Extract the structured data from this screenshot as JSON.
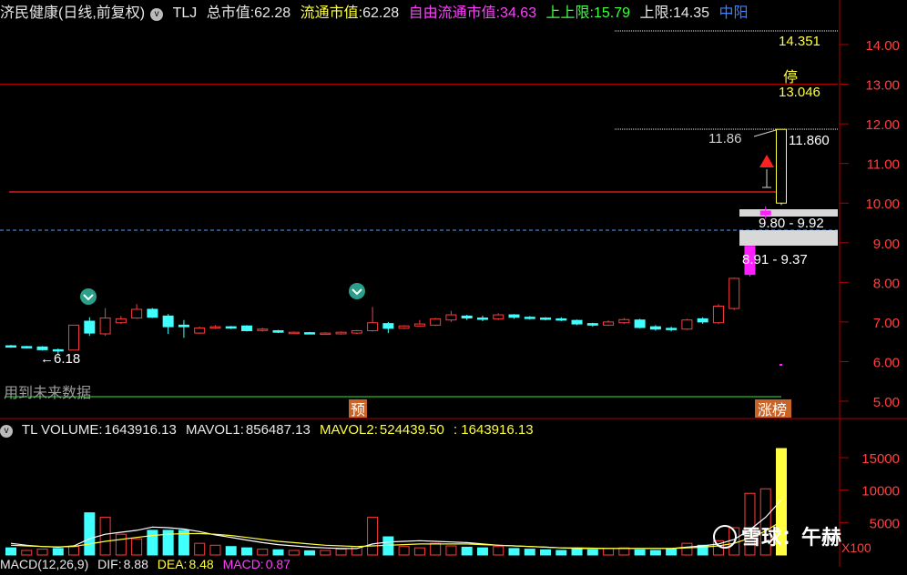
{
  "header": {
    "stock_name": "济民健康(日线,前复权)",
    "indicator": "TLJ",
    "total_mcap_label": "总市值:",
    "total_mcap": "62.28",
    "float_mcap_label": "流通市值:",
    "float_mcap": "62.28",
    "free_float_label": "自由流通市值:",
    "free_float": "34.63",
    "upper_limit2_label": "上上限:",
    "upper_limit2": "15.79",
    "upper_limit_label": "上限:",
    "upper_limit": "14.35",
    "truncated_label": "中阳"
  },
  "price_axis": {
    "ticks": [
      "14.00",
      "13.00",
      "12.00",
      "11.00",
      "10.00",
      "9.00",
      "8.00",
      "7.00",
      "6.00",
      "5.00"
    ]
  },
  "price_labels": {
    "level_14": "14.351",
    "stop_char": "停",
    "level_13": "13.046",
    "high_left": "11.86",
    "high_right": "11.860",
    "gap_upper": "9.80 - 9.92",
    "gap_lower": "8.91 - 9.37",
    "low_marker": "6.18",
    "future_data_note": "用到未来数据",
    "pre_tag": "预",
    "limit_up_tag": "涨榜"
  },
  "volume_header": {
    "name": "TL VOLUME:",
    "volume": "1643916.13",
    "mavol1_label": "MAVOL1:",
    "mavol1": "856487.13",
    "mavol2_label": "MAVOL2:",
    "mavol2": "524439.50",
    "extra": ": 1643916.13"
  },
  "volume_axis": {
    "ticks": [
      "15000",
      "10000",
      "5000"
    ],
    "unit": "X100"
  },
  "macd_header": {
    "name": "MACD(12,26,9)",
    "dif_label": "DIF:",
    "dif": "8.88",
    "dea_label": "DEA:",
    "dea": "8.48",
    "macd_label": "MACD:",
    "macd": "0.87"
  },
  "watermark": "雪球：午赫",
  "colors": {
    "up": "#ff3b3b",
    "down": "#40ffff",
    "limit": "#ff20ff",
    "ma1": "#ffffff",
    "ma2": "#ffff40",
    "grid": "#b00000"
  },
  "chart_data": {
    "type": "candlestick",
    "x_label": "",
    "y_range": [
      4.7,
      14.5
    ],
    "candles": [
      {
        "o": 6.4,
        "c": 6.38,
        "h": 6.42,
        "l": 6.35
      },
      {
        "o": 6.38,
        "c": 6.36,
        "h": 6.4,
        "l": 6.33
      },
      {
        "o": 6.37,
        "c": 6.3,
        "h": 6.39,
        "l": 6.28
      },
      {
        "o": 6.3,
        "c": 6.29,
        "h": 6.33,
        "l": 6.18
      },
      {
        "o": 6.29,
        "c": 6.92,
        "h": 6.92,
        "l": 6.29
      },
      {
        "o": 7.02,
        "c": 6.72,
        "h": 7.12,
        "l": 6.65
      },
      {
        "o": 6.7,
        "c": 7.1,
        "h": 7.35,
        "l": 6.65
      },
      {
        "o": 6.98,
        "c": 7.08,
        "h": 7.15,
        "l": 6.95
      },
      {
        "o": 7.1,
        "c": 7.32,
        "h": 7.45,
        "l": 7.08
      },
      {
        "o": 7.32,
        "c": 7.12,
        "h": 7.35,
        "l": 7.1
      },
      {
        "o": 7.15,
        "c": 6.88,
        "h": 7.2,
        "l": 6.7
      },
      {
        "o": 6.92,
        "c": 6.88,
        "h": 7.05,
        "l": 6.6
      },
      {
        "o": 6.72,
        "c": 6.85,
        "h": 6.88,
        "l": 6.7
      },
      {
        "o": 6.85,
        "c": 6.88,
        "h": 6.92,
        "l": 6.82
      },
      {
        "o": 6.88,
        "c": 6.86,
        "h": 6.9,
        "l": 6.82
      },
      {
        "o": 6.9,
        "c": 6.78,
        "h": 6.92,
        "l": 6.76
      },
      {
        "o": 6.8,
        "c": 6.82,
        "h": 6.85,
        "l": 6.76
      },
      {
        "o": 6.78,
        "c": 6.74,
        "h": 6.8,
        "l": 6.72
      },
      {
        "o": 6.72,
        "c": 6.74,
        "h": 6.76,
        "l": 6.7
      },
      {
        "o": 6.73,
        "c": 6.72,
        "h": 6.75,
        "l": 6.7
      },
      {
        "o": 6.72,
        "c": 6.72,
        "h": 6.74,
        "l": 6.7
      },
      {
        "o": 6.7,
        "c": 6.74,
        "h": 6.76,
        "l": 6.68
      },
      {
        "o": 6.72,
        "c": 6.78,
        "h": 6.8,
        "l": 6.7
      },
      {
        "o": 6.78,
        "c": 6.98,
        "h": 7.38,
        "l": 6.76
      },
      {
        "o": 6.96,
        "c": 6.84,
        "h": 7.0,
        "l": 6.72
      },
      {
        "o": 6.84,
        "c": 6.9,
        "h": 6.92,
        "l": 6.82
      },
      {
        "o": 6.9,
        "c": 6.95,
        "h": 7.05,
        "l": 6.88
      },
      {
        "o": 6.92,
        "c": 7.08,
        "h": 7.1,
        "l": 6.9
      },
      {
        "o": 7.05,
        "c": 7.18,
        "h": 7.28,
        "l": 7.0
      },
      {
        "o": 7.15,
        "c": 7.1,
        "h": 7.18,
        "l": 7.05
      },
      {
        "o": 7.1,
        "c": 7.08,
        "h": 7.16,
        "l": 7.02
      },
      {
        "o": 7.08,
        "c": 7.18,
        "h": 7.22,
        "l": 7.05
      },
      {
        "o": 7.18,
        "c": 7.12,
        "h": 7.2,
        "l": 7.08
      },
      {
        "o": 7.12,
        "c": 7.1,
        "h": 7.15,
        "l": 7.06
      },
      {
        "o": 7.1,
        "c": 7.08,
        "h": 7.12,
        "l": 7.04
      },
      {
        "o": 7.08,
        "c": 7.06,
        "h": 7.12,
        "l": 7.02
      },
      {
        "o": 7.04,
        "c": 6.95,
        "h": 7.06,
        "l": 6.92
      },
      {
        "o": 6.96,
        "c": 6.92,
        "h": 6.98,
        "l": 6.88
      },
      {
        "o": 6.92,
        "c": 7.0,
        "h": 7.04,
        "l": 6.9
      },
      {
        "o": 6.98,
        "c": 7.06,
        "h": 7.1,
        "l": 6.95
      },
      {
        "o": 7.05,
        "c": 6.86,
        "h": 7.08,
        "l": 6.84
      },
      {
        "o": 6.88,
        "c": 6.82,
        "h": 6.92,
        "l": 6.78
      },
      {
        "o": 6.84,
        "c": 6.82,
        "h": 6.88,
        "l": 6.76
      },
      {
        "o": 6.82,
        "c": 7.05,
        "h": 7.08,
        "l": 6.8
      },
      {
        "o": 7.08,
        "c": 7.0,
        "h": 7.12,
        "l": 6.95
      },
      {
        "o": 6.98,
        "c": 7.4,
        "h": 7.45,
        "l": 6.95
      },
      {
        "o": 7.34,
        "c": 8.1,
        "h": 8.12,
        "l": 7.3
      },
      {
        "o": 8.2,
        "c": 8.91,
        "h": 8.91,
        "l": 8.15
      },
      {
        "o": 9.7,
        "c": 9.8,
        "h": 9.92,
        "l": 9.6
      },
      {
        "o": 10.0,
        "c": 11.86,
        "h": 11.86,
        "l": 9.95
      }
    ],
    "volumes": [
      {
        "v": 1100,
        "up": false
      },
      {
        "v": 700,
        "up": true
      },
      {
        "v": 900,
        "up": true
      },
      {
        "v": 1000,
        "up": false
      },
      {
        "v": 1300,
        "up": true
      },
      {
        "v": 6500,
        "up": false
      },
      {
        "v": 5800,
        "up": true
      },
      {
        "v": 3200,
        "up": true
      },
      {
        "v": 2500,
        "up": true
      },
      {
        "v": 3800,
        "up": false
      },
      {
        "v": 3800,
        "up": false
      },
      {
        "v": 3800,
        "up": false
      },
      {
        "v": 1800,
        "up": true
      },
      {
        "v": 1500,
        "up": true
      },
      {
        "v": 1300,
        "up": false
      },
      {
        "v": 1100,
        "up": false
      },
      {
        "v": 900,
        "up": true
      },
      {
        "v": 800,
        "up": false
      },
      {
        "v": 700,
        "up": true
      },
      {
        "v": 650,
        "up": false
      },
      {
        "v": 700,
        "up": true
      },
      {
        "v": 900,
        "up": true
      },
      {
        "v": 1300,
        "up": true
      },
      {
        "v": 5800,
        "up": true
      },
      {
        "v": 2800,
        "up": false
      },
      {
        "v": 1300,
        "up": true
      },
      {
        "v": 1100,
        "up": true
      },
      {
        "v": 1800,
        "up": true
      },
      {
        "v": 1400,
        "up": true
      },
      {
        "v": 1200,
        "up": false
      },
      {
        "v": 1100,
        "up": false
      },
      {
        "v": 1300,
        "up": true
      },
      {
        "v": 1000,
        "up": false
      },
      {
        "v": 900,
        "up": false
      },
      {
        "v": 800,
        "up": false
      },
      {
        "v": 700,
        "up": false
      },
      {
        "v": 900,
        "up": false
      },
      {
        "v": 800,
        "up": false
      },
      {
        "v": 1000,
        "up": true
      },
      {
        "v": 1100,
        "up": true
      },
      {
        "v": 800,
        "up": false
      },
      {
        "v": 700,
        "up": false
      },
      {
        "v": 900,
        "up": false
      },
      {
        "v": 1800,
        "up": true
      },
      {
        "v": 1500,
        "up": false
      },
      {
        "v": 2200,
        "up": true
      },
      {
        "v": 4200,
        "up": true
      },
      {
        "v": 9500,
        "up": true
      },
      {
        "v": 10200,
        "up": true
      },
      {
        "v": 16400,
        "up": true
      }
    ],
    "volume_range": [
      0,
      17500
    ],
    "mavol1": [
      1800,
      1500,
      1300,
      1200,
      1400,
      2500,
      3200,
      3500,
      3800,
      4300,
      4200,
      4000,
      3600,
      3100,
      2700,
      2300,
      1900,
      1600,
      1400,
      1200,
      1100,
      1000,
      1000,
      1700,
      2000,
      2100,
      2200,
      2100,
      2000,
      1900,
      1700,
      1500,
      1400,
      1300,
      1200,
      1100,
      1000,
      1000,
      1000,
      1000,
      1000,
      1000,
      1000,
      1200,
      1400,
      1700,
      2400,
      3900,
      5800,
      8500
    ],
    "mavol2": [
      1500,
      1400,
      1300,
      1250,
      1300,
      1700,
      2100,
      2400,
      2700,
      3000,
      3200,
      3300,
      3300,
      3200,
      3000,
      2700,
      2400,
      2100,
      1900,
      1700,
      1500,
      1400,
      1300,
      1400,
      1500,
      1600,
      1700,
      1700,
      1700,
      1700,
      1600,
      1500,
      1400,
      1300,
      1200,
      1100,
      1100,
      1050,
      1000,
      1000,
      1000,
      1000,
      1000,
      1100,
      1200,
      1400,
      1800,
      2600,
      3700,
      5200
    ]
  }
}
